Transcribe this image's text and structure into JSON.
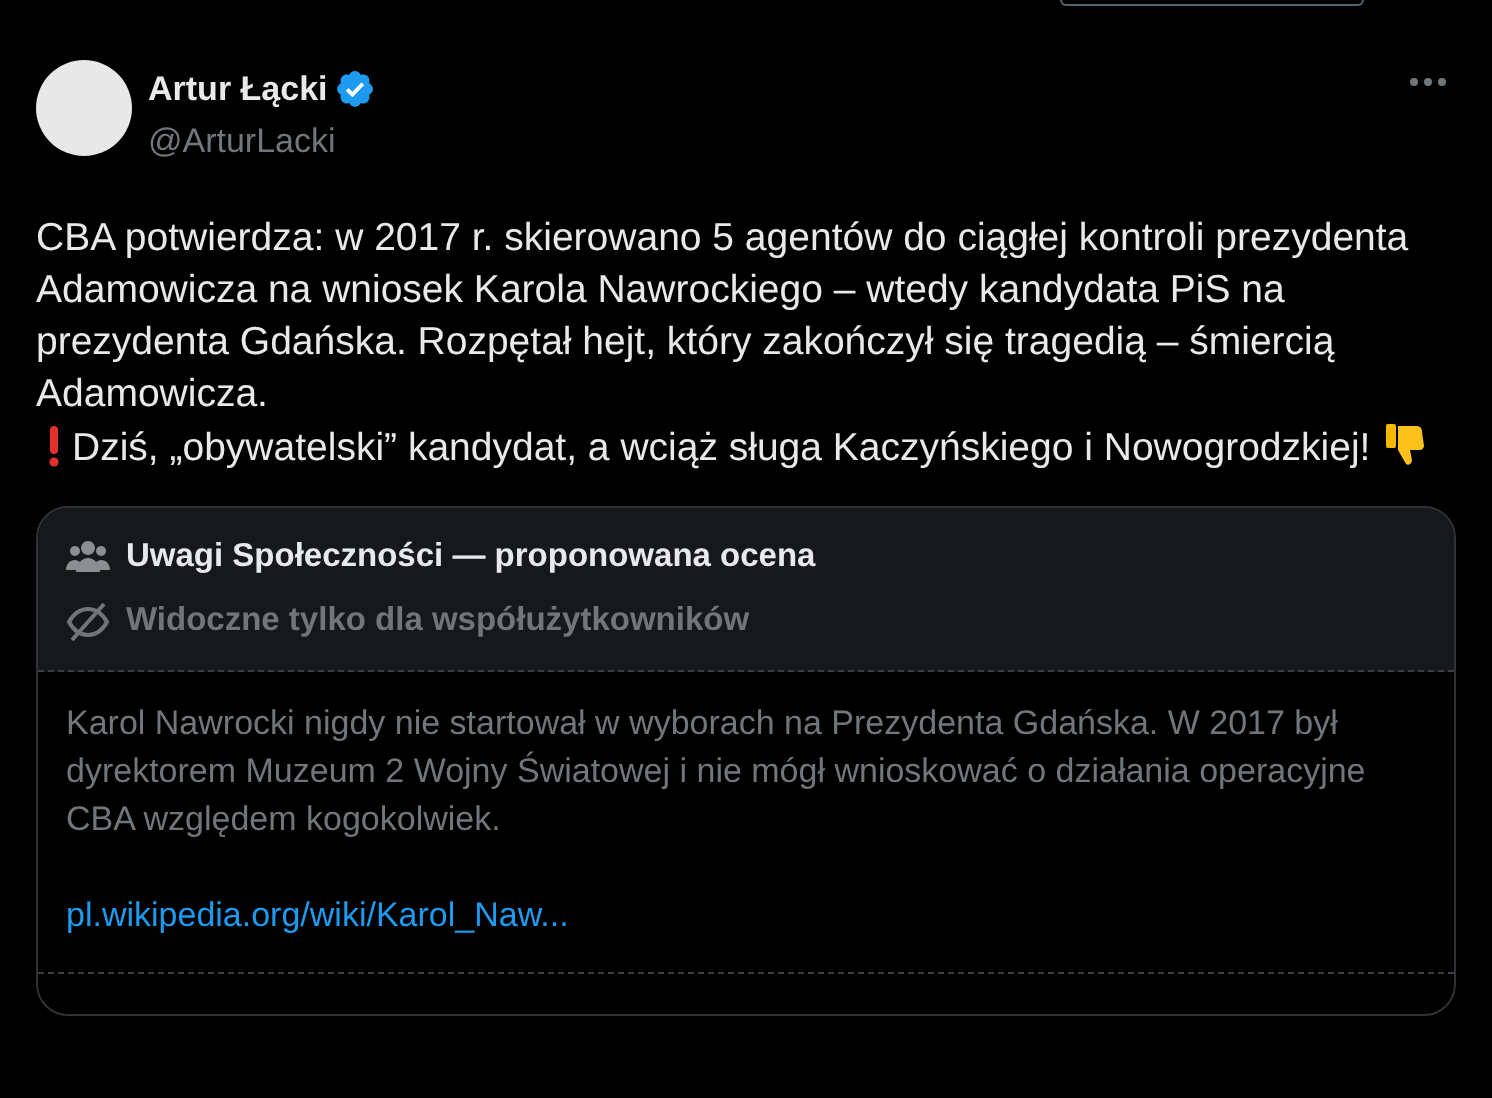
{
  "author": {
    "name": "Artur Łącki",
    "handle": "@ArturLacki",
    "verified": true
  },
  "post": {
    "text": "CBA potwierdza: w 2017 r. skierowano 5 agentów do ciągłej kontroli prezydenta Adamowicza na wniosek Karola Nawrockiego – wtedy kandydata PiS na prezydenta Gdańska. Rozpętał hejt, który zakończył się tragedią – śmiercią Adamowicza.",
    "text_2": "Dziś, „obywatelski” kandydat, a wciąż sługa Kaczyńskiego i Nowogrodzkiej!"
  },
  "community_note": {
    "title": "Uwagi Społeczności — proponowana ocena",
    "visibility": "Widoczne tylko dla współużytkowników",
    "text": "Karol Nawrocki nigdy nie startował w wyborach na Prezydenta Gdańska. W 2017 był dyrektorem Muzeum 2 Wojny Światowej i nie mógł wnioskować o działania operacyjne CBA względem kogokolwiek.",
    "link": "pl.wikipedia.org/wiki/Karol_Naw..."
  }
}
